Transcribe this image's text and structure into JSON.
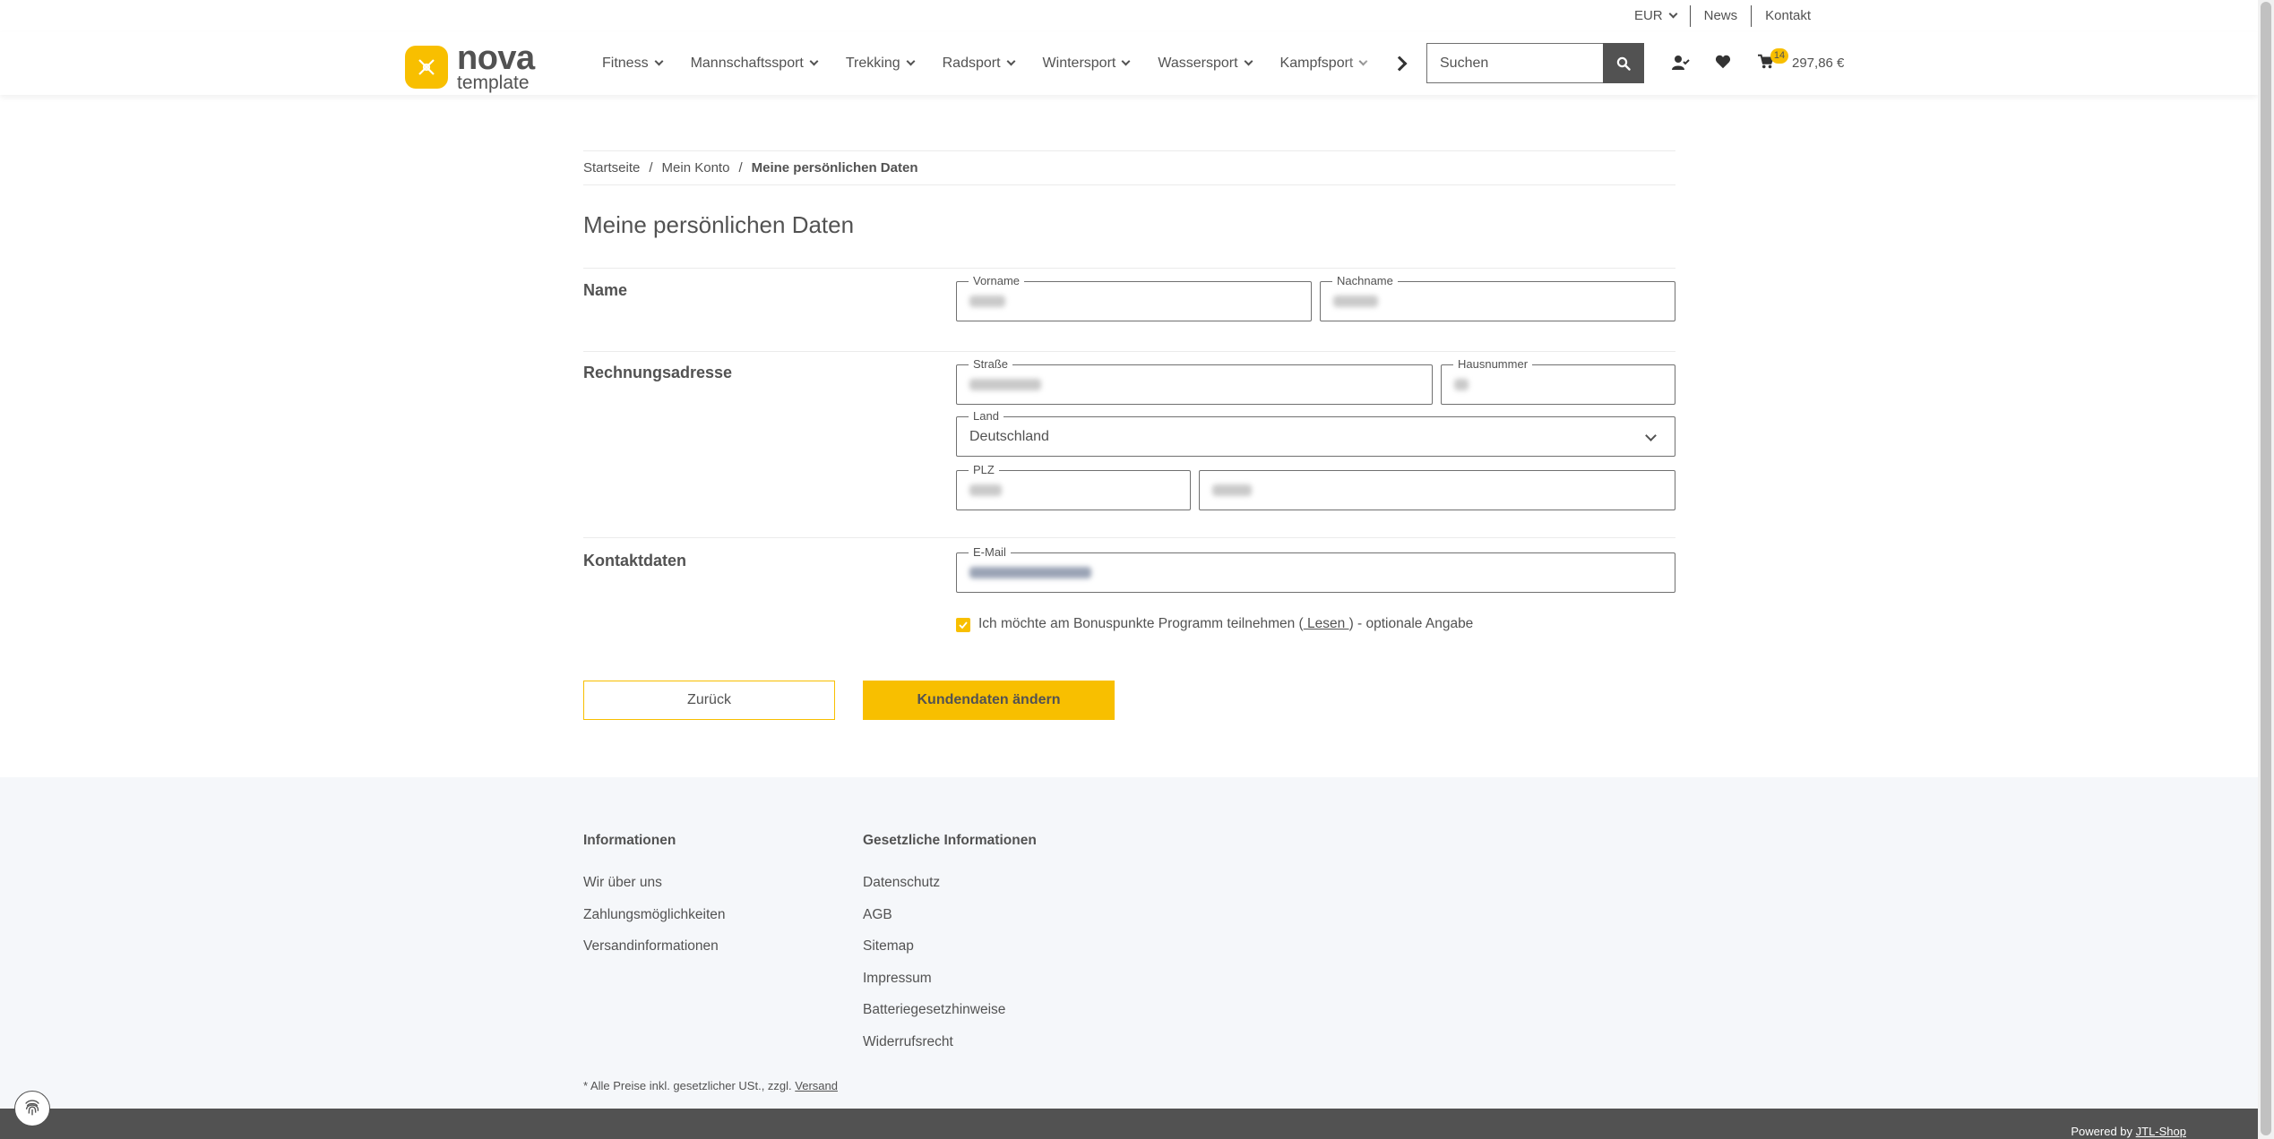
{
  "topbar": {
    "currency": "EUR",
    "news": "News",
    "contact": "Kontakt"
  },
  "logo": {
    "name": "nova",
    "sub": "template"
  },
  "nav": {
    "items": [
      "Fitness",
      "Mannschaftssport",
      "Trekking",
      "Radsport",
      "Wintersport",
      "Wassersport",
      "Kampfsport"
    ]
  },
  "search": {
    "placeholder": "Suchen"
  },
  "cart": {
    "count": "14",
    "total": "297,86 €"
  },
  "breadcrumb": {
    "home": "Startseite",
    "account": "Mein Konto",
    "current": "Meine persönlichen Daten"
  },
  "page": {
    "title": "Meine persönlichen Daten"
  },
  "sections": {
    "name": "Name",
    "billing": "Rechnungsadresse",
    "contact": "Kontaktdaten"
  },
  "fields": {
    "firstname_label": "Vorname",
    "lastname_label": "Nachname",
    "street_label": "Straße",
    "housenumber_label": "Hausnummer",
    "country_label": "Land",
    "country_value": "Deutschland",
    "zip_label": "PLZ",
    "email_label": "E-Mail"
  },
  "bonus": {
    "text_before": "Ich möchte am Bonuspunkte Programm teilnehmen (",
    "link": " Lesen ",
    "text_after": ") - optionale Angabe"
  },
  "buttons": {
    "back": "Zurück",
    "submit": "Kundendaten ändern"
  },
  "footer": {
    "col1_title": "Informationen",
    "col1_links": [
      "Wir über uns",
      "Zahlungsmöglichkeiten",
      "Versandinformationen"
    ],
    "col2_title": "Gesetzliche Informationen",
    "col2_links": [
      "Datenschutz",
      "AGB",
      "Sitemap",
      "Impressum",
      "Batteriegesetzhinweise",
      "Widerrufsrecht"
    ],
    "note_before": "* Alle Preise inkl. gesetzlicher USt., zzgl. ",
    "note_link": "Versand",
    "powered_before": "Powered by ",
    "powered_link": "JTL-Shop"
  },
  "colors": {
    "accent": "#f8bf00",
    "text": "#525252",
    "footer_bg": "#f5f7fa"
  }
}
